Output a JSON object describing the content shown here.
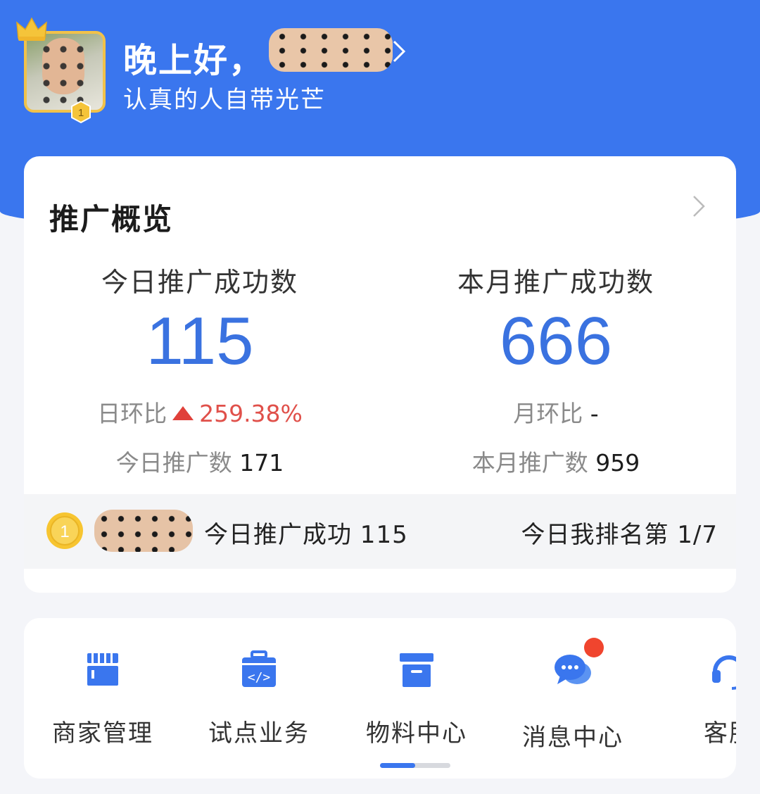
{
  "header": {
    "greeting": "晚上好，",
    "motto": "认真的人自带光芒",
    "avatar_level": "1"
  },
  "overview": {
    "title": "推广概览",
    "today": {
      "label": "今日推广成功数",
      "value": "115",
      "ratio_label": "日环比",
      "ratio_value": "259.38%",
      "count_label": "今日推广数",
      "count_value": "171"
    },
    "month": {
      "label": "本月推广成功数",
      "value": "666",
      "ratio_label": "月环比",
      "ratio_value": "-",
      "count_label": "本月推广数",
      "count_value": "959"
    },
    "ranking": {
      "medal": "1",
      "text": "今日推广成功 115",
      "position": "今日我排名第 1/7"
    }
  },
  "actions": [
    {
      "label": "商家管理",
      "icon": "store-icon"
    },
    {
      "label": "试点业务",
      "icon": "code-briefcase-icon"
    },
    {
      "label": "物料中心",
      "icon": "archive-box-icon"
    },
    {
      "label": "消息中心",
      "icon": "chat-bubbles-icon"
    },
    {
      "label": "客服",
      "icon": "headset-icon"
    }
  ],
  "colors": {
    "header_blue": "#3a76ee",
    "value_blue": "#3a72e0",
    "up_red": "#e0504a",
    "notice_dot": "#f0452e"
  }
}
